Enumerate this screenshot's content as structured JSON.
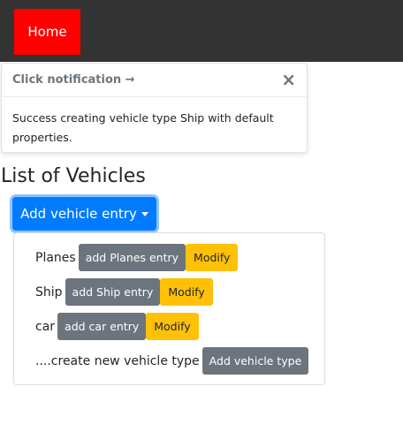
{
  "navbar": {
    "home_label": "Home",
    "colors": {
      "background": "#333333",
      "home": "#ff0000"
    }
  },
  "notification": {
    "title": "Click notification →",
    "close_symbol": "×",
    "message": "Success creating vehicle type Ship with default properties."
  },
  "vehicles": {
    "heading": "List of Vehicles",
    "add_entry_label": "Add vehicle entry",
    "items": [
      {
        "name": "Planes",
        "add_label": "add Planes entry",
        "modify_label": "Modify"
      },
      {
        "name": "Ship",
        "add_label": "add Ship entry",
        "modify_label": "Modify"
      },
      {
        "name": "car",
        "add_label": "add car entry",
        "modify_label": "Modify"
      }
    ],
    "create_new": {
      "label": "....create new vehicle type",
      "button_label": "Add vehicle type"
    }
  }
}
